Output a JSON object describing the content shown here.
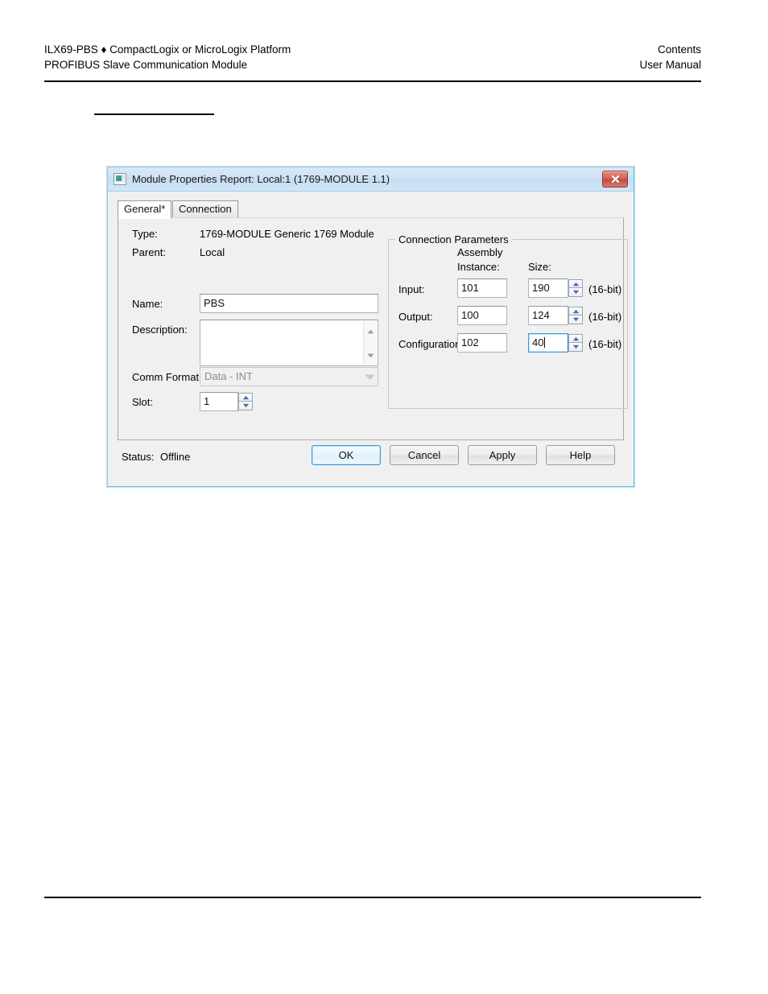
{
  "page": {
    "header": {
      "left_line1": "ILX69-PBS ♦ CompactLogix or MicroLogix Platform",
      "left_line2": "PROFIBUS Slave Communication Module",
      "right_line1": "Contents",
      "right_line2": "User Manual"
    }
  },
  "dialog": {
    "title": "Module Properties Report: Local:1 (1769-MODULE 1.1)",
    "close_tooltip": "Close",
    "tabs": [
      {
        "label": "General*",
        "active": true
      },
      {
        "label": "Connection",
        "active": false
      }
    ],
    "fields": {
      "type_label": "Type:",
      "type_value": "1769-MODULE Generic 1769 Module",
      "parent_label": "Parent:",
      "parent_value": "Local",
      "name_label": "Name:",
      "name_value": "PBS",
      "name_placeholder": "",
      "description_label": "Description:",
      "description_value": "",
      "description_placeholder": "",
      "comm_format_label": "Comm Format:",
      "comm_format_value": "Data - INT",
      "slot_label": "Slot:",
      "slot_value": "1"
    },
    "connection_parameters": {
      "group_title": "Connection Parameters",
      "col_assembly_line1": "Assembly",
      "col_assembly_line2": "Instance:",
      "col_size": "Size:",
      "rows": [
        {
          "label": "Input:",
          "instance": "101",
          "size": "190",
          "unit": "(16-bit)",
          "focused": false
        },
        {
          "label": "Output:",
          "instance": "100",
          "size": "124",
          "unit": "(16-bit)",
          "focused": false
        },
        {
          "label": "Configuration:",
          "instance": "102",
          "size": "40",
          "unit": "(16-bit)",
          "focused": true
        }
      ]
    },
    "status": {
      "label": "Status:",
      "value": "Offline"
    },
    "buttons": [
      {
        "label": "OK",
        "default": true
      },
      {
        "label": "Cancel",
        "default": false
      },
      {
        "label": "Apply",
        "default": false
      },
      {
        "label": "Help",
        "default": false
      }
    ]
  },
  "colors": {
    "titlebar": "#cfe2f4",
    "dialog_border_accent": "#5bc8f5",
    "close_button": "#c44f40",
    "focus_blue": "#3c97d4",
    "spinner_arrow": "#4a6fb5"
  }
}
